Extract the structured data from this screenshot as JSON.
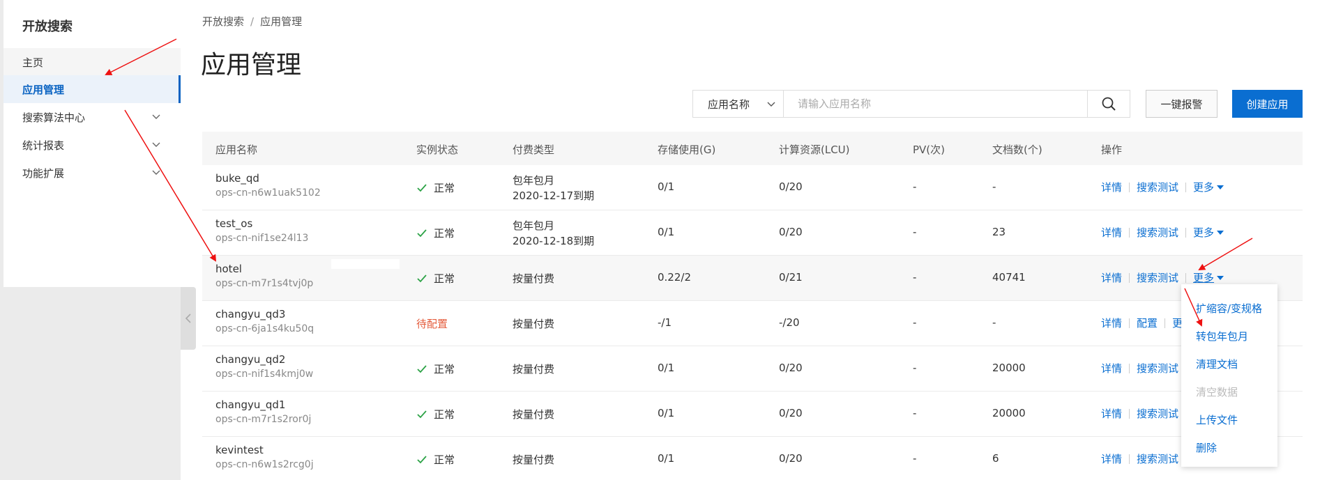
{
  "sidebar": {
    "title": "开放搜索",
    "items": [
      {
        "label": "主页"
      },
      {
        "label": "应用管理"
      },
      {
        "label": "搜索算法中心"
      },
      {
        "label": "统计报表"
      },
      {
        "label": "功能扩展"
      }
    ]
  },
  "breadcrumb": {
    "root": "开放搜索",
    "sep": "/",
    "current": "应用管理"
  },
  "page_title": "应用管理",
  "toolbar": {
    "select_value": "应用名称",
    "search_placeholder": "请输入应用名称",
    "alarm_label": "一键报警",
    "create_label": "创建应用"
  },
  "table": {
    "headers": [
      "应用名称",
      "实例状态",
      "付费类型",
      "存储使用(G)",
      "计算资源(LCU)",
      "PV(次)",
      "文档数(个)",
      "操作"
    ],
    "rows": [
      {
        "name": "buke_qd",
        "id": "ops-cn-n6w1uak5102",
        "status": "正常",
        "pay": "包年包月",
        "pay_date": "2020-12-17到期",
        "storage": "0/1",
        "compute": "0/20",
        "pv": "-",
        "docs": "-",
        "ops": [
          "详情",
          "搜索测试",
          "更多"
        ]
      },
      {
        "name": "test_os",
        "id": "ops-cn-nif1se24l13",
        "status": "正常",
        "pay": "包年包月",
        "pay_date": "2020-12-18到期",
        "storage": "0/1",
        "compute": "0/20",
        "pv": "-",
        "docs": "23",
        "ops": [
          "详情",
          "搜索测试",
          "更多"
        ]
      },
      {
        "name": "hotel",
        "id": "ops-cn-m7r1s4tvj0p",
        "status": "正常",
        "pay": "按量付费",
        "pay_date": "",
        "storage": "0.22/2",
        "compute": "0/21",
        "pv": "-",
        "docs": "40741",
        "ops": [
          "详情",
          "搜索测试",
          "更多"
        ]
      },
      {
        "name": "changyu_qd3",
        "id": "ops-cn-6ja1s4ku50q",
        "status": "待配置",
        "pay": "按量付费",
        "pay_date": "",
        "storage": "-/1",
        "compute": "-/20",
        "pv": "-",
        "docs": "-",
        "ops": [
          "详情",
          "配置",
          "更"
        ]
      },
      {
        "name": "changyu_qd2",
        "id": "ops-cn-nif1s4kmj0w",
        "status": "正常",
        "pay": "按量付费",
        "pay_date": "",
        "storage": "0/1",
        "compute": "0/20",
        "pv": "-",
        "docs": "20000",
        "ops": [
          "详情",
          "搜索测试"
        ]
      },
      {
        "name": "changyu_qd1",
        "id": "ops-cn-m7r1s2ror0j",
        "status": "正常",
        "pay": "按量付费",
        "pay_date": "",
        "storage": "0/1",
        "compute": "0/20",
        "pv": "-",
        "docs": "20000",
        "ops": [
          "详情",
          "搜索测试"
        ]
      },
      {
        "name": "kevintest",
        "id": "ops-cn-n6w1s2rcg0j",
        "status": "正常",
        "pay": "按量付费",
        "pay_date": "",
        "storage": "0/1",
        "compute": "0/20",
        "pv": "-",
        "docs": "6",
        "ops": [
          "详情",
          "搜索测试"
        ]
      }
    ]
  },
  "dropdown": {
    "items": [
      {
        "label": "扩缩容/变规格",
        "disabled": false
      },
      {
        "label": "转包年包月",
        "disabled": false
      },
      {
        "label": "清理文档",
        "disabled": false
      },
      {
        "label": "清空数据",
        "disabled": true
      },
      {
        "label": "上传文件",
        "disabled": false
      },
      {
        "label": "删除",
        "disabled": false
      }
    ]
  },
  "colors": {
    "accent": "#0a6ed1",
    "ok": "#2ba245",
    "warn": "#e45c3c",
    "annotation": "#ee1111"
  }
}
